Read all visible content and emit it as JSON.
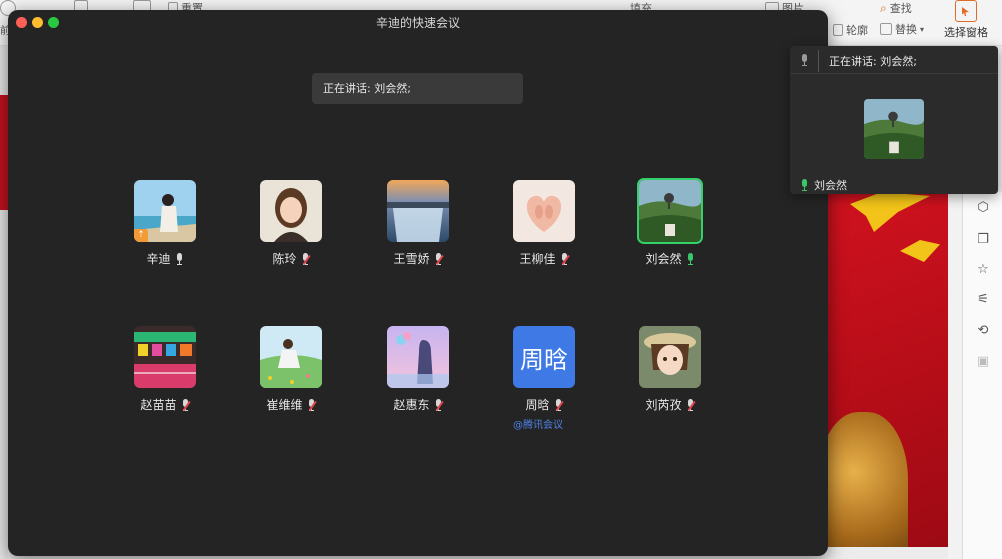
{
  "background_app": {
    "toolbar": {
      "redo_label": "重置",
      "fill_label": "填充",
      "outline_label": "轮廓",
      "picture_label": "图片",
      "find_label": "查找",
      "replace_label": "替换",
      "selection_pane_label": "选择窗格"
    },
    "side_icons": [
      "cube-icon",
      "copy-icon",
      "pin-icon",
      "sliders-icon",
      "history-icon",
      "image-icon"
    ]
  },
  "meeting": {
    "window_title": "辛迪的快速会议",
    "speaking_banner": "正在讲话: 刘会然;",
    "participants": [
      {
        "name": "辛迪",
        "mic": "on",
        "avatar": "photo-beach-girl",
        "sharing": true
      },
      {
        "name": "陈玲",
        "mic": "muted",
        "avatar": "photo-smiling-girl"
      },
      {
        "name": "王雪娇",
        "mic": "muted",
        "avatar": "photo-waterfall"
      },
      {
        "name": "王柳佳",
        "mic": "muted",
        "avatar": "photo-baby-feet-heart"
      },
      {
        "name": "刘会然",
        "mic": "speaking",
        "avatar": "photo-balloon-landscape",
        "active": true
      },
      {
        "name": "赵苗苗",
        "mic": "muted",
        "avatar": "photo-colorful-street"
      },
      {
        "name": "崔维维",
        "mic": "muted",
        "avatar": "illustration-girl-meadow"
      },
      {
        "name": "赵惠东",
        "mic": "muted",
        "avatar": "illustration-girl-balloons"
      },
      {
        "name": "周晗",
        "mic": "muted",
        "avatar_text": "周晗",
        "avatar_color": "#3f79e6"
      },
      {
        "name": "刘芮孜",
        "mic": "muted",
        "avatar": "anime-girl-hat"
      }
    ],
    "watermark": "@腾讯会议"
  },
  "floating_panel": {
    "speaking_text": "正在讲话: 刘会然;",
    "speaker_name": "刘会然"
  },
  "colors": {
    "window_bg": "#242424",
    "active_border": "#35d06a",
    "muted_red": "#e0454b",
    "avatar_blue": "#3f79e6",
    "share_badge": "#f29a36"
  }
}
